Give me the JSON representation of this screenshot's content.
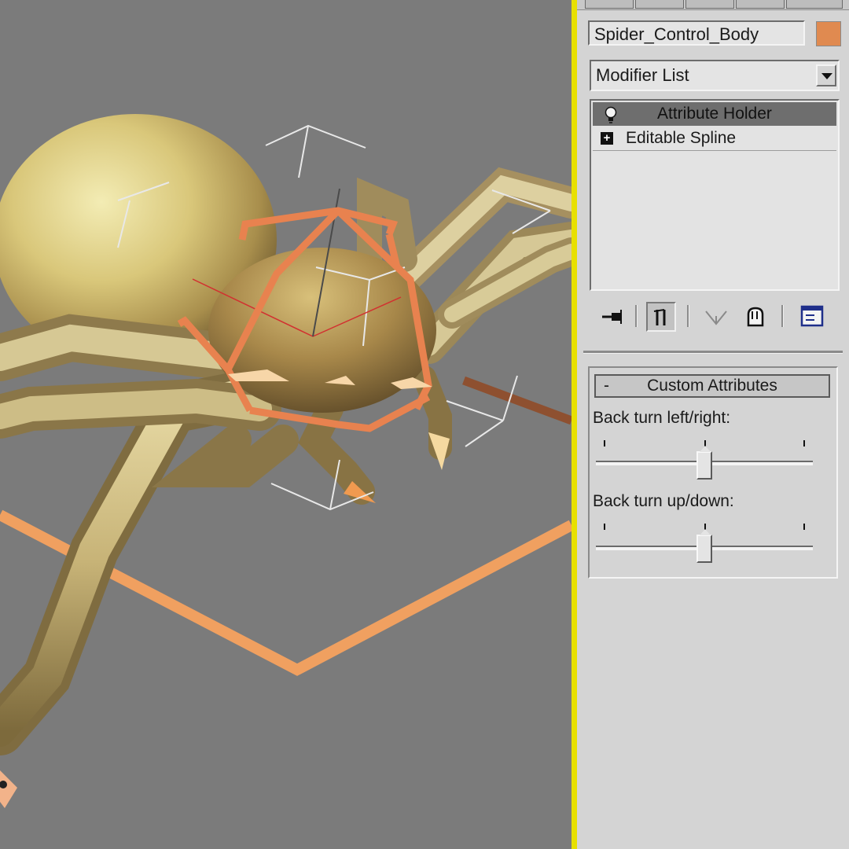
{
  "object_name": "Spider_Control_Body",
  "object_color": "#e08a50",
  "modifier_list": {
    "label": "Modifier List"
  },
  "modifier_stack": [
    {
      "label": "Attribute Holder",
      "selected": true,
      "icon": "lightbulb-icon"
    },
    {
      "label": "Editable Spline",
      "selected": false,
      "icon": "expand-plus-icon"
    }
  ],
  "stack_tools": [
    {
      "icon": "pin-stack-icon"
    },
    {
      "icon": "show-end-result-icon",
      "pressed": true
    },
    {
      "icon": "make-unique-icon"
    },
    {
      "icon": "remove-modifier-icon"
    },
    {
      "icon": "configure-modifier-sets-icon"
    }
  ],
  "custom_attributes": {
    "title": "Custom Attributes",
    "collapse_symbol": "-",
    "sliders": [
      {
        "label": "Back turn left/right:",
        "value": 0.5
      },
      {
        "label": "Back turn up/down:",
        "value": 0.5
      }
    ]
  },
  "colors": {
    "viewport_background": "#7b7b7b",
    "active_viewport_border": "#e8e000",
    "control_spline": "#e8824f",
    "selection_bracket": "#e8e8e8"
  }
}
